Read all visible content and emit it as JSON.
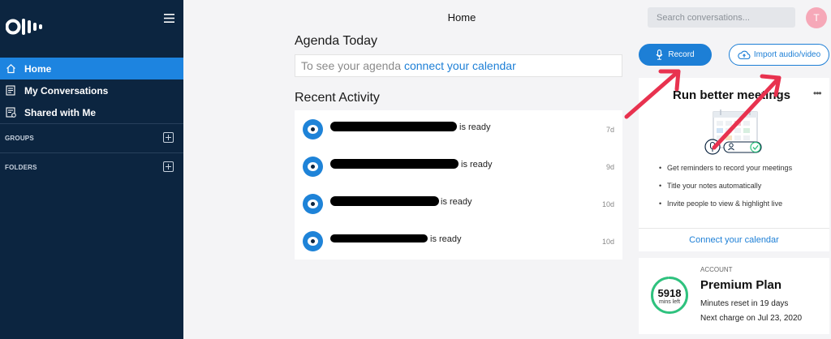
{
  "sidebar": {
    "logo_text": "Otter",
    "nav": [
      {
        "label": "Home",
        "icon": "home-icon"
      },
      {
        "label": "My Conversations",
        "icon": "conversations-icon"
      },
      {
        "label": "Shared with Me",
        "icon": "shared-icon"
      }
    ],
    "groups_label": "GROUPS",
    "folders_label": "FOLDERS"
  },
  "header": {
    "title": "Home",
    "search_placeholder": "Search conversations...",
    "avatar_initial": "T"
  },
  "agenda": {
    "heading": "Agenda Today",
    "prefix": "To see your agenda",
    "link": "connect your calendar"
  },
  "activity": {
    "heading": "Recent Activity",
    "items": [
      {
        "status": "is ready",
        "time": "7d",
        "redacted": true
      },
      {
        "status": "is ready",
        "time": "9d",
        "redacted": true
      },
      {
        "status": "is ready",
        "time": "10d",
        "redacted": true
      },
      {
        "status": "is ready",
        "time": "10d",
        "redacted": true
      }
    ]
  },
  "actions": {
    "record_label": "Record",
    "import_label": "Import audio/video"
  },
  "meetings_card": {
    "title": "Run better meetings",
    "bullets": [
      "Get reminders to record your meetings",
      "Title your notes automatically",
      "Invite people to view & highlight live"
    ],
    "cta": "Connect your calendar"
  },
  "account": {
    "label": "ACCOUNT",
    "plan": "Premium Plan",
    "minutes_left": "5918",
    "minutes_unit": "mins left",
    "minutes_fraction": 0.98,
    "reset": "Minutes reset in 19 days",
    "next_charge": "Next charge on Jul 23, 2020"
  },
  "colors": {
    "sidebar_bg": "#0c2540",
    "accent": "#1d7fd6",
    "active_nav": "#1d84e0",
    "ring": "#2ec27e",
    "annotation_arrow": "#e8324f"
  }
}
